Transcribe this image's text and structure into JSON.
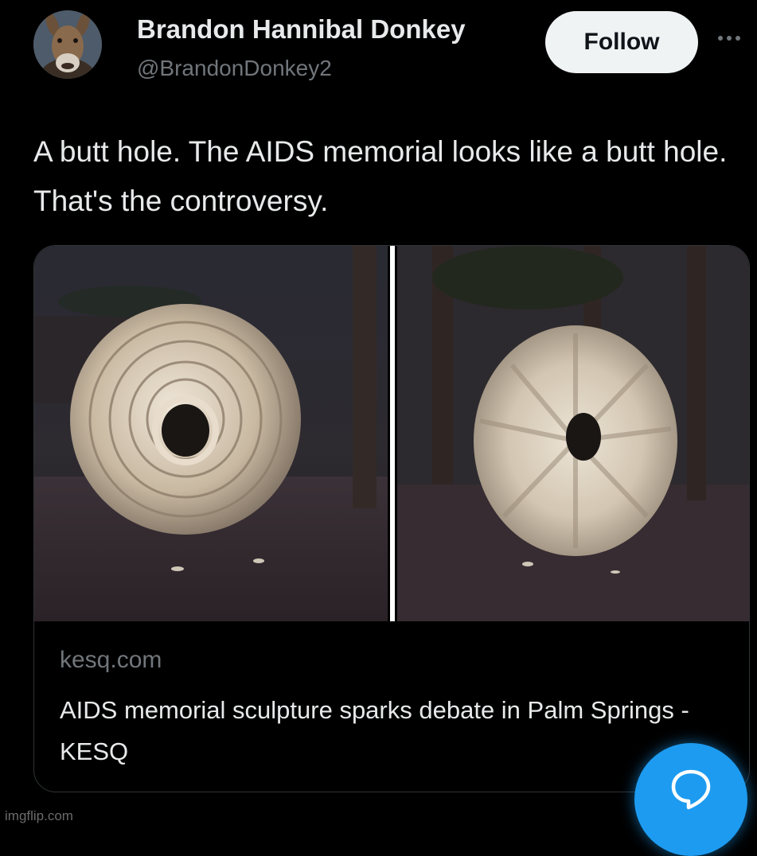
{
  "author": {
    "display_name": "Brandon Hannibal Donkey",
    "handle": "@BrandonDonkey2"
  },
  "follow_label": "Follow",
  "more_icon": "more-horizontal-icon",
  "tweet": {
    "text": "A butt hole. The AIDS memorial looks like a butt hole. That's the controversy."
  },
  "link_card": {
    "domain": "kesq.com",
    "title": "AIDS memorial sculpture sparks debate in Palm Springs - KESQ"
  },
  "watermark": "imgflip.com",
  "fab_icon": "speech-bubble-icon",
  "colors": {
    "background": "#000000",
    "text": "#e7e9ea",
    "secondary_text": "#71767b",
    "follow_button": "#eff3f4",
    "accent": "#1d9bf0"
  }
}
